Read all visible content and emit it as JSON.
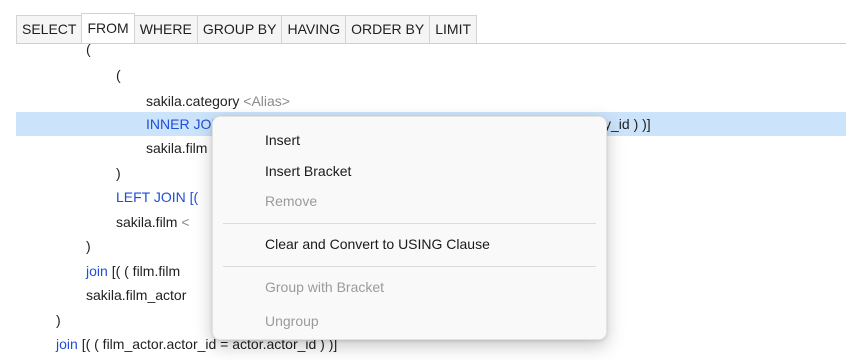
{
  "tabs": [
    "SELECT",
    "FROM",
    "WHERE",
    "GROUP BY",
    "HAVING",
    "ORDER BY",
    "LIMIT"
  ],
  "active_tab": "FROM",
  "colors": {
    "keyword": "#1f4fd6",
    "alias_placeholder": "#8a8a8a",
    "row_highlight": "#cce4fb",
    "menu_background": "#f9f9f9",
    "disabled_text": "#9b9b9b"
  },
  "tree": {
    "paren_open_1": "(",
    "paren_open_2": "(",
    "category_table": "sakila.category",
    "category_alias": "<Alias>",
    "inner_join_kw": "INNER JOI",
    "inner_join_tail": "y_id ) )]",
    "film_table_partial": "sakila.film",
    "paren_close_2": ")",
    "left_join_kw": "LEFT JOIN",
    "left_join_rest": "[(",
    "film_table": "sakila.film",
    "film_alias_partial": "<",
    "paren_close_1": ")",
    "join1_kw": "join",
    "join1_rest": "[( ( film.film",
    "film_actor_table": "sakila.film_actor",
    "paren_close_0": ")",
    "join2_kw": "join",
    "join2_rest": "[( ( film_actor.actor_id = actor.actor_id ) )]"
  },
  "context_menu": {
    "items": [
      {
        "label": "Insert",
        "enabled": true
      },
      {
        "label": "Insert Bracket",
        "enabled": true
      },
      {
        "label": "Remove",
        "enabled": false
      },
      {
        "label": "Clear and Convert to USING Clause",
        "enabled": true
      },
      {
        "label": "Group with Bracket",
        "enabled": false
      },
      {
        "label": "Ungroup",
        "enabled": false
      }
    ]
  }
}
